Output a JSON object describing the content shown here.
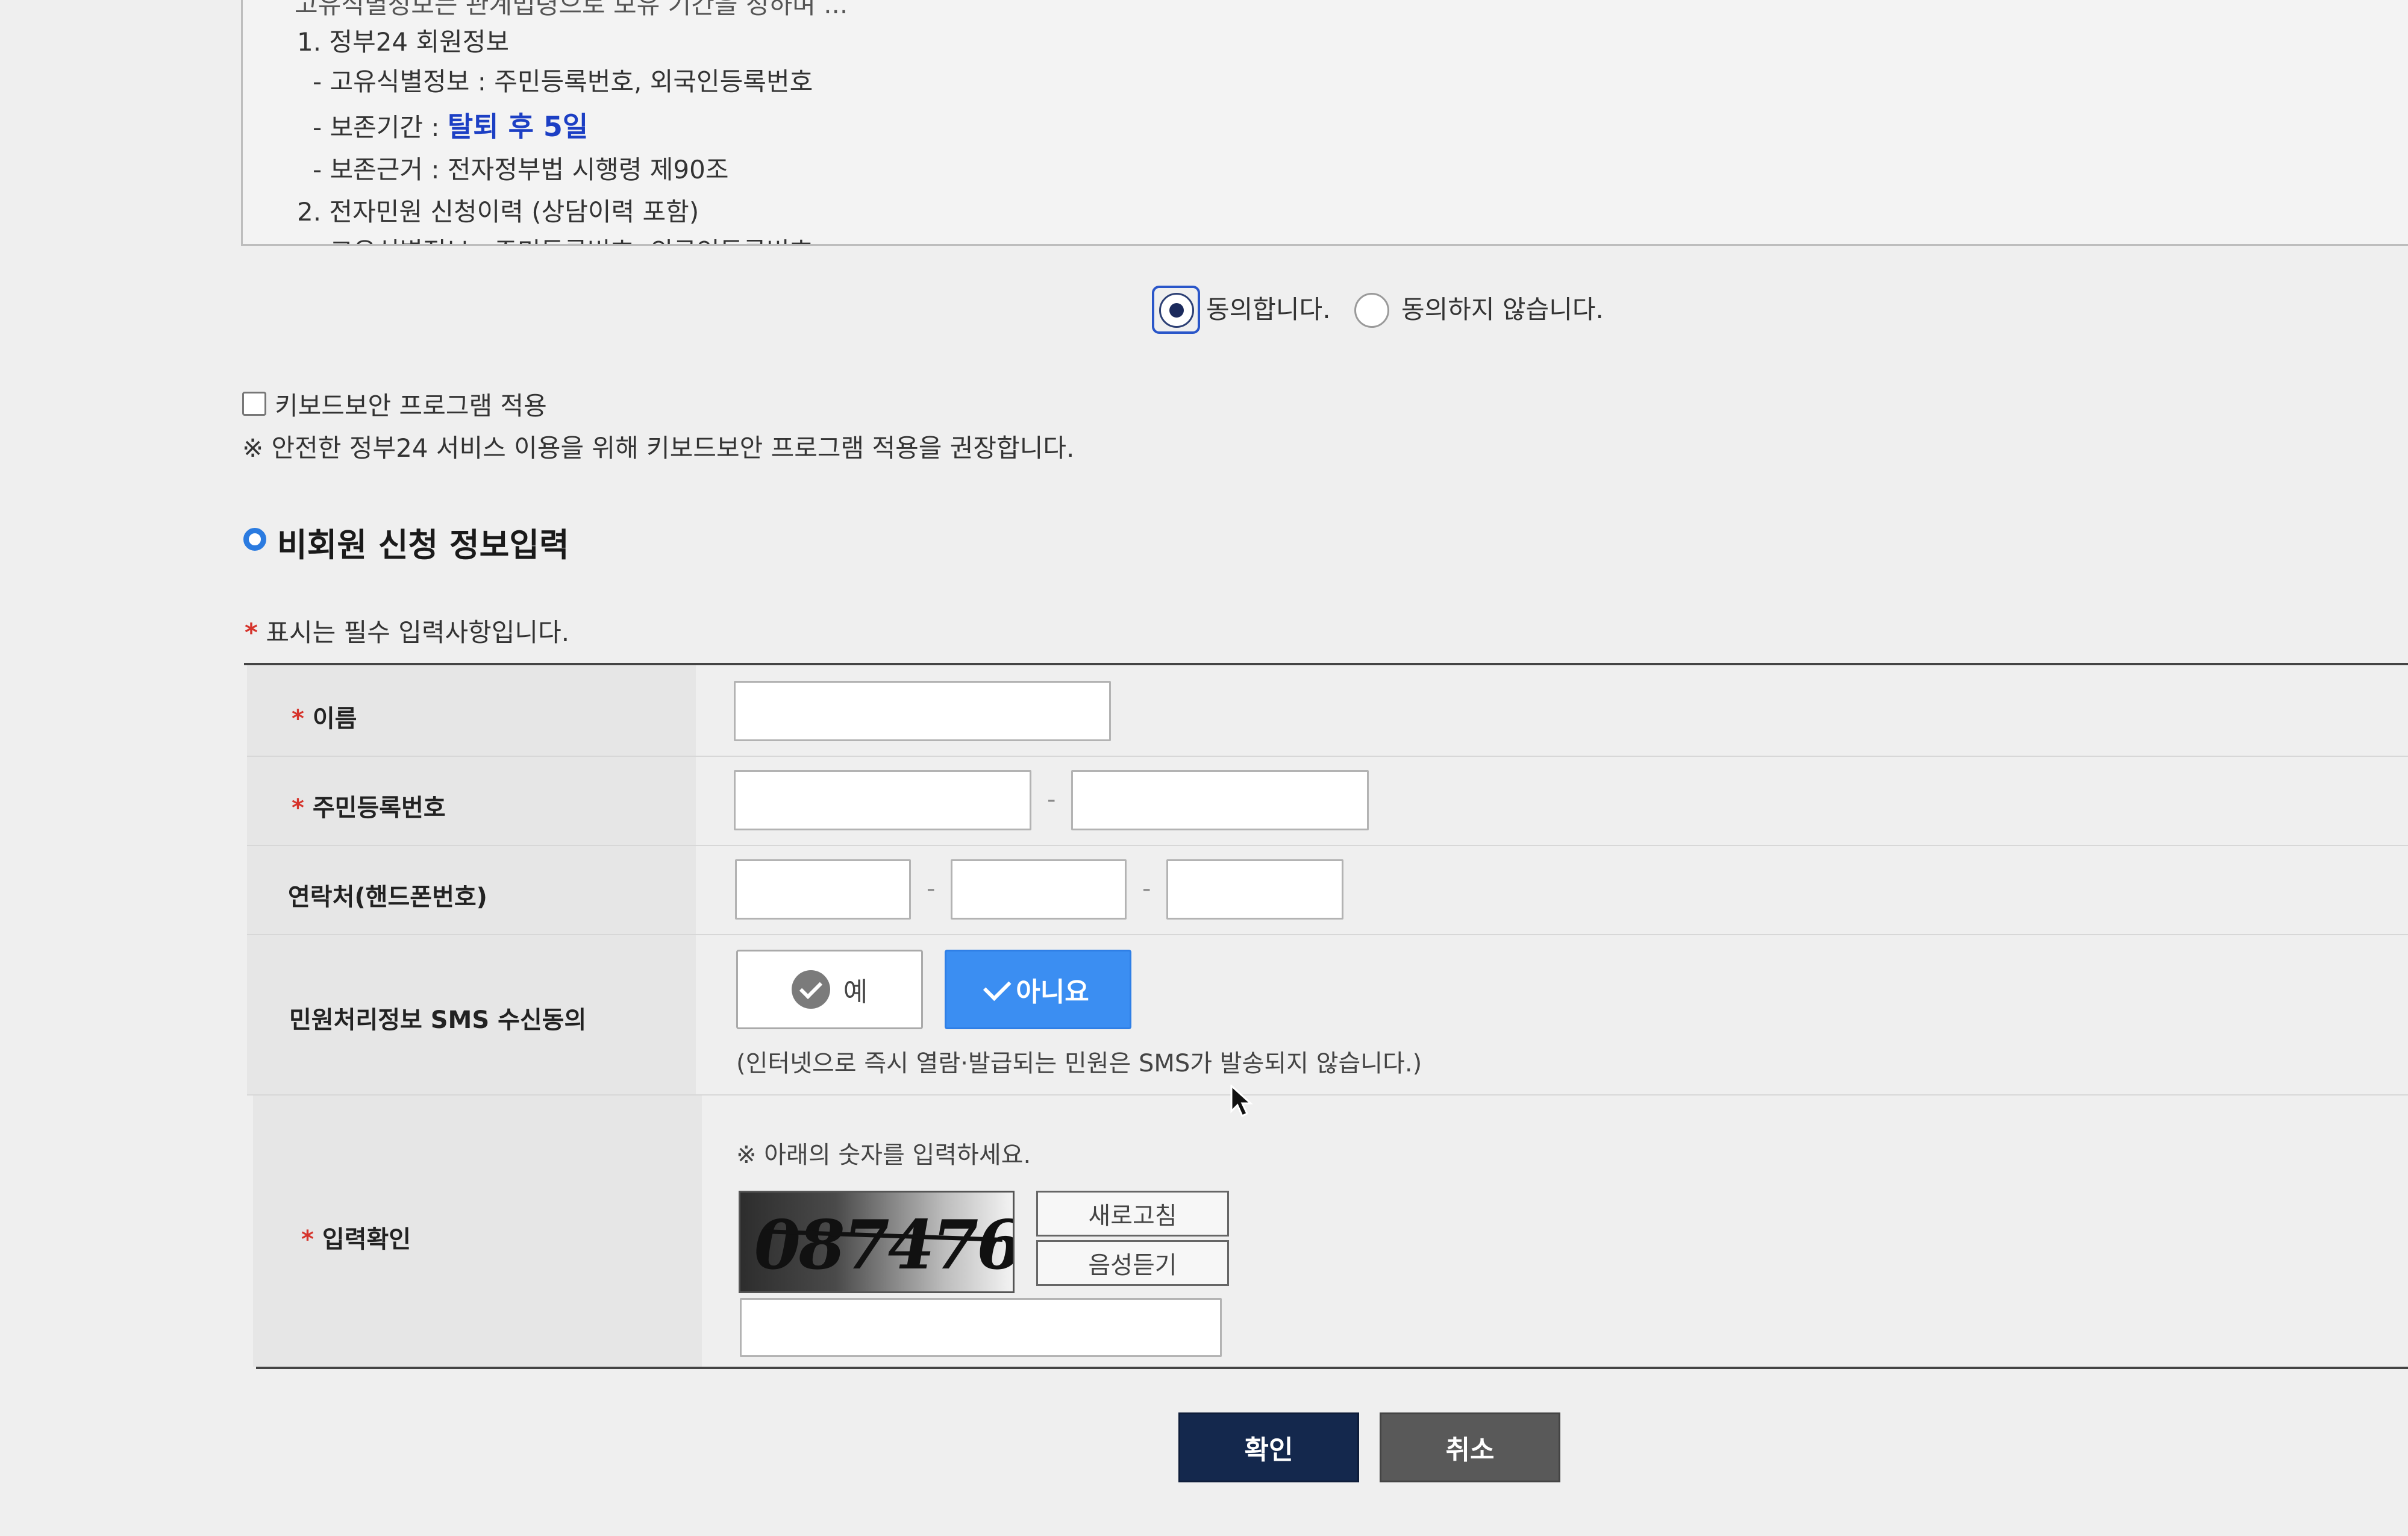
{
  "terms": {
    "cut_top_line": "고유식별정보는 관계법령으로 보유 기간을 정하며 ...",
    "item1_title": "1. 정부24 회원정보",
    "item1_id_info": "- 고유식별정보 : 주민등록번호, 외국인등록번호",
    "item1_retention_label": "- 보존기간 : ",
    "item1_retention_value": "탈퇴 후 5일",
    "item1_basis": "- 보존근거 : 전자정부법 시행령 제90조",
    "item2_title": "2. 전자민원 신청이력 (상담이력 포함)",
    "item2_cut": "- 고유식별정보 : 주민등록번호, 외국인등록번호"
  },
  "consent": {
    "agree_label": "동의합니다.",
    "disagree_label": "동의하지 않습니다.",
    "selected": "agree"
  },
  "keyboard_security": {
    "checkbox_label": "키보드보안 프로그램 적용",
    "notice": "※ 안전한 정부24 서비스 이용을 위해 키보드보안 프로그램 적용을 권장합니다.",
    "checked": false
  },
  "section": {
    "title": "비회원 신청 정보입력",
    "required_star": "*",
    "required_notice": "표시는 필수 입력사항입니다."
  },
  "form": {
    "name_label": "이름",
    "rrn_label": "주민등록번호",
    "phone_label": "연락처(핸드폰번호)",
    "sms_label": "민원처리정보 SMS 수신동의",
    "sms_yes": "예",
    "sms_no": "아니요",
    "sms_selected": "아니요",
    "sms_note": "(인터넷으로 즉시 열람·발급되는 민원은 SMS가 발송되지 않습니다.)",
    "captcha_label": "입력확인",
    "captcha_instruction": "※ 아래의 숫자를 입력하세요.",
    "captcha_value": "087476",
    "refresh_button": "새로고침",
    "audio_button": "음성듣기",
    "dash": "-"
  },
  "buttons": {
    "confirm": "확인",
    "cancel": "취소"
  },
  "colors": {
    "accent_blue": "#3b8ef2",
    "navy": "#14284d",
    "highlight_text": "#1c3fc4",
    "required": "#d6342c"
  }
}
